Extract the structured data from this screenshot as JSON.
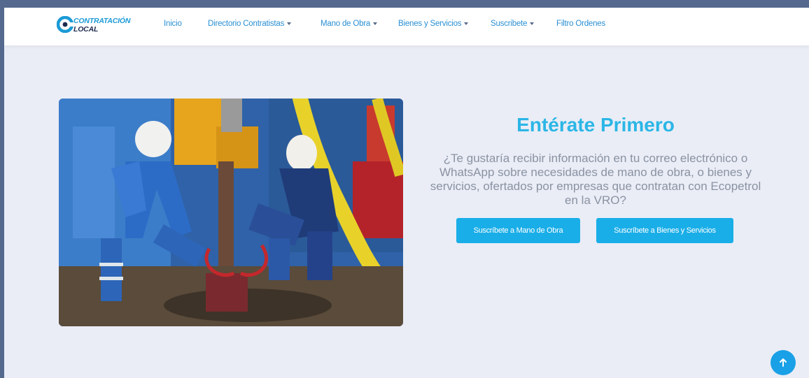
{
  "logo": {
    "line1": "CONTRATACIÓN",
    "line2": "LOCAL"
  },
  "nav": {
    "items": [
      {
        "label": "Inicio",
        "has_dropdown": false
      },
      {
        "label": "Directorio Contratistas",
        "has_dropdown": true
      },
      {
        "label": "Mano de Obra",
        "has_dropdown": true
      },
      {
        "label": "Bienes y Servicios",
        "has_dropdown": true
      },
      {
        "label": "Suscribete",
        "has_dropdown": true
      },
      {
        "label": "Filtro Ordenes",
        "has_dropdown": false
      }
    ]
  },
  "hero": {
    "title": "Entérate Primero",
    "text": "¿Te gustaría recibir información en tu correo electrónico o WhatsApp sobre necesidades de mano de obra, o bienes y servicios, ofertados por empresas que contratan con Ecopetrol en la VRO?",
    "image": "oil-rig-workers-photo"
  },
  "buttons": {
    "subscribe_labor": "Suscríbete a Mano de Obra",
    "subscribe_goods": "Suscríbete a Bienes y Servicios"
  },
  "icons": {
    "scroll_top": "arrow-up-icon"
  },
  "colors": {
    "accent": "#2bb6e6",
    "button": "#1aaee8",
    "nav_text": "#2a8fd4",
    "page_bg": "#eaedf6",
    "frame": "#55698e"
  }
}
